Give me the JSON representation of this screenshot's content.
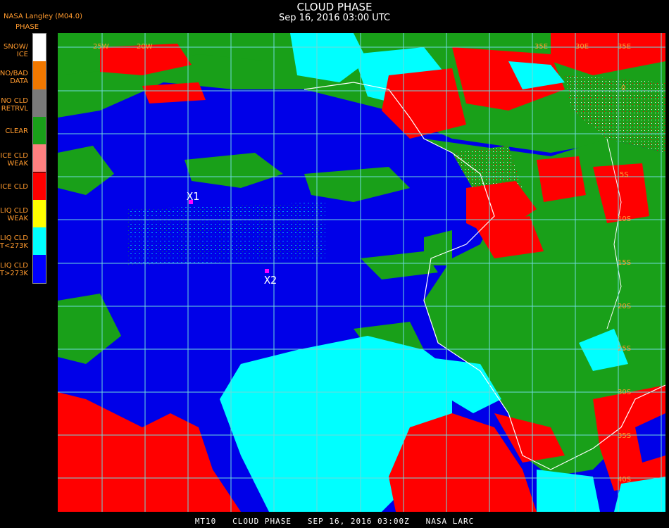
{
  "header": {
    "title": "CLOUD PHASE",
    "datetime": "Sep 16, 2016 03:00 UTC",
    "credit": "NASA Langley (M04.0)",
    "legend_title": "PHASE"
  },
  "legend": [
    {
      "label": "SNOW/\nICE",
      "color": "#ffffff"
    },
    {
      "label": "NO/BAD\nDATA",
      "color": "#f07800"
    },
    {
      "label": "NO CLD\nRETRVL",
      "color": "#7a7a7a"
    },
    {
      "label": "CLEAR",
      "color": "#19a019"
    },
    {
      "label": "ICE CLD\nWEAK",
      "color": "#ff8080"
    },
    {
      "label": "ICE CLD",
      "color": "#ff0000"
    },
    {
      "label": "LIQ CLD\nWEAK",
      "color": "#ffff00"
    },
    {
      "label": "LIQ CLD\nT<273K",
      "color": "#00ffff"
    },
    {
      "label": "LIQ CLD\nT>273K",
      "color": "#0000ff"
    }
  ],
  "map": {
    "lon_labels": [
      "25W",
      "20W",
      "35E",
      "30E",
      "35E"
    ],
    "lat_labels": [
      "0",
      "5S",
      "10S",
      "15S",
      "20S",
      "25S",
      "30S",
      "35S",
      "40S"
    ],
    "colors": {
      "ocean_liq": "#0000e8",
      "land_clear": "#19a019",
      "ice": "#ff0000",
      "liq_cold": "#00ffff",
      "grid": "#6fdada",
      "coast": "#ffffff"
    }
  },
  "markers": [
    {
      "label": "X1"
    },
    {
      "label": "X2"
    }
  ],
  "footer": "MT10   CLOUD PHASE   SEP 16, 2016 03:00Z   NASA LARC"
}
